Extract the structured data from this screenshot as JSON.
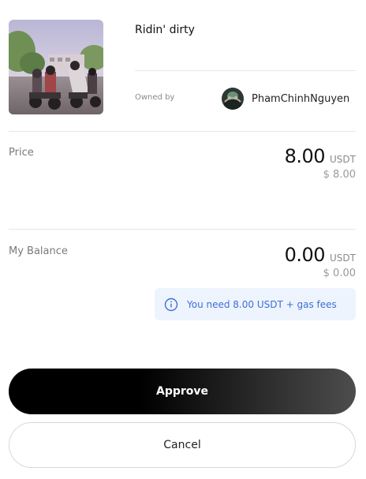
{
  "item": {
    "title": "Ridin' dirty",
    "owned_by_label": "Owned by",
    "owner_name": "PhamChinhNguyen"
  },
  "price": {
    "label": "Price",
    "amount": "8.00",
    "unit": "USDT",
    "fiat": "$ 8.00"
  },
  "balance": {
    "label": "My Balance",
    "amount": "0.00",
    "unit": "USDT",
    "fiat": "$ 0.00"
  },
  "notice": {
    "icon": "info-icon",
    "text": "You need 8.00 USDT + gas fees",
    "color": "#3d6fd6",
    "background": "#eef4fe"
  },
  "actions": {
    "approve_label": "Approve",
    "cancel_label": "Cancel"
  }
}
